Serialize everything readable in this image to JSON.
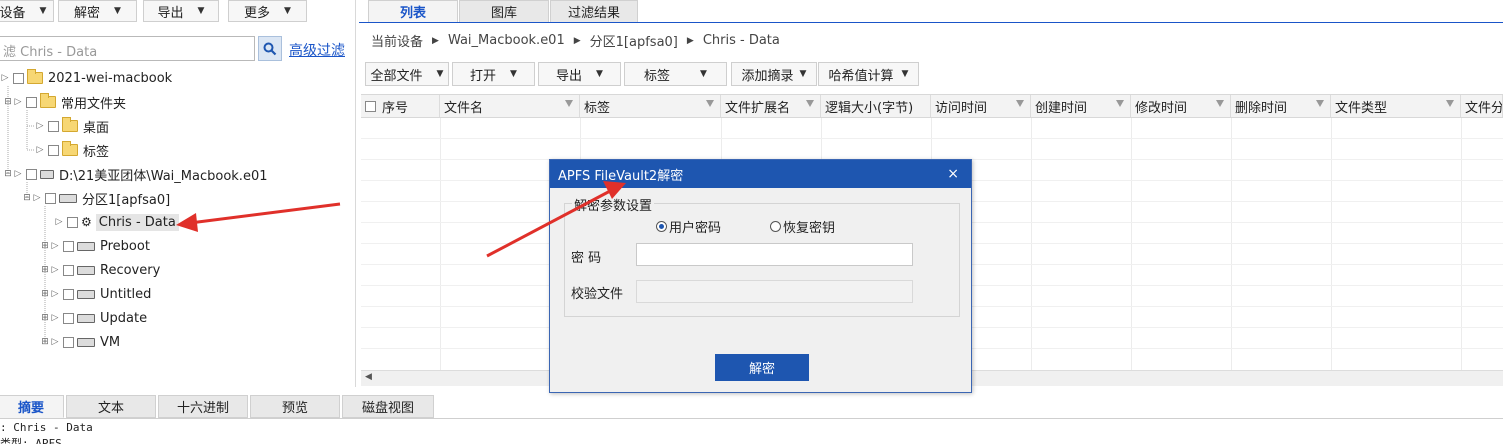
{
  "left": {
    "top_dropdowns": [
      "设备",
      "解密",
      "导出",
      "更多"
    ],
    "search_placeholder": "滤 Chris - Data",
    "advanced_filter": "高级过滤",
    "tree": {
      "root": "2021-wei-macbook",
      "common_folders": "常用文件夹",
      "desktop": "桌面",
      "tags": "标签",
      "image_path": "D:\\21美亚团体\\Wai_Macbook.e01",
      "partition": "分区1[apfsa0]",
      "volumes": [
        "Chris - Data",
        "Preboot",
        "Recovery",
        "Untitled",
        "Update",
        "VM"
      ]
    }
  },
  "tabs": [
    "列表",
    "图库",
    "过滤结果"
  ],
  "breadcrumb": [
    "当前设备",
    "Wai_Macbook.e01",
    "分区1[apfsa0]",
    "Chris - Data"
  ],
  "toolbar": [
    "全部文件",
    "打开",
    "导出",
    "标签",
    "添加摘录",
    "哈希值计算"
  ],
  "columns": [
    "序号",
    "文件名",
    "标签",
    "文件扩展名",
    "逻辑大小(字节)",
    "访问时间",
    "创建时间",
    "修改时间",
    "删除时间",
    "文件类型",
    "文件分"
  ],
  "bottom_tabs": [
    "摘要",
    "文本",
    "十六进制",
    "预览",
    "磁盘视图"
  ],
  "summary_lines": [
    ": Chris - Data",
    "类型: APFS"
  ],
  "dialog": {
    "title": "APFS FileVault2解密",
    "close": "×",
    "group_label": "解密参数设置",
    "radio_user_password": "用户密码",
    "radio_recovery_key": "恢复密钥",
    "password_label": "密  码",
    "verify_file_label": "校验文件",
    "password_value": "",
    "verify_file_value": "",
    "decrypt_button": "解密"
  },
  "colors": {
    "accent": "#1e56b0",
    "link": "#1a55c8",
    "arrow": "#e0302a"
  }
}
